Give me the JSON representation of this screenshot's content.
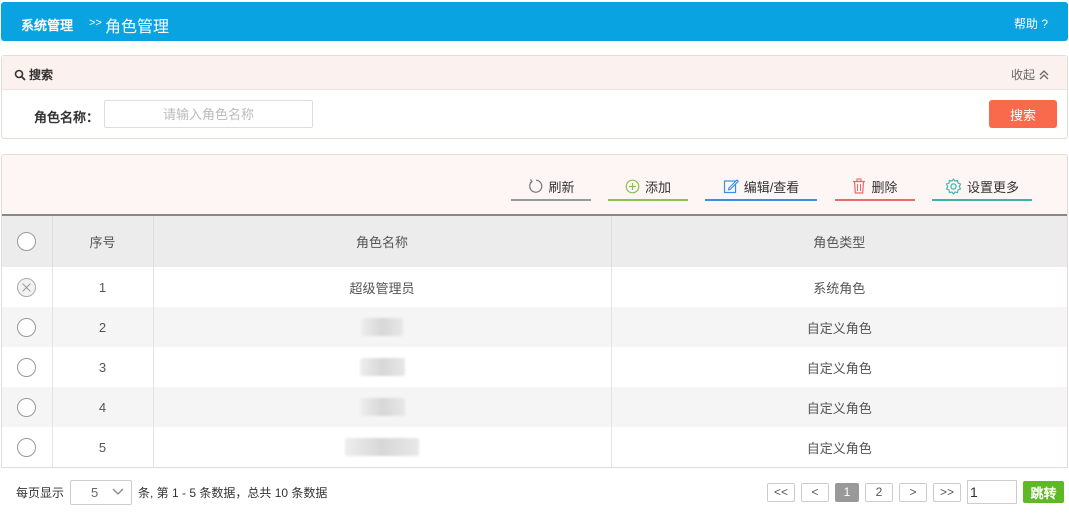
{
  "header": {
    "crumb_root": "系统管理",
    "crumb_sep": ">>",
    "crumb_current": "角色管理",
    "help": "帮助 ?"
  },
  "search": {
    "title": "搜索",
    "collapse": "收起",
    "label": "角色名称：",
    "placeholder": "请输入角色名称",
    "button": "搜索"
  },
  "toolbar": {
    "refresh": "刷新",
    "add": "添加",
    "edit": "编辑/查看",
    "delete": "删除",
    "settings": "设置更多"
  },
  "table": {
    "headers": [
      "序号",
      "角色名称",
      "角色类型"
    ],
    "rows": [
      {
        "index": "1",
        "name": "超级管理员",
        "type": "系统角色",
        "disabled": true
      },
      {
        "index": "2",
        "name": "",
        "type": "自定义角色",
        "disabled": false
      },
      {
        "index": "3",
        "name": "",
        "type": "自定义角色",
        "disabled": false
      },
      {
        "index": "4",
        "name": "",
        "type": "自定义角色",
        "disabled": false
      },
      {
        "index": "5",
        "name": "",
        "type": "自定义角色",
        "disabled": false
      }
    ]
  },
  "pager": {
    "per_page_label": "每页显示",
    "page_size": "5",
    "summary": "条, 第 1 - 5 条数据，总共 10 条数据",
    "first": "<<",
    "prev": "<",
    "pages": [
      "1",
      "2"
    ],
    "current_page": "1",
    "next": ">",
    "last": ">>",
    "jump_value": "1",
    "jump_button": "跳转"
  },
  "colors": {
    "header_bg": "#0aa3e2",
    "search_button": "#f9694b",
    "jump_button": "#5fb826"
  }
}
